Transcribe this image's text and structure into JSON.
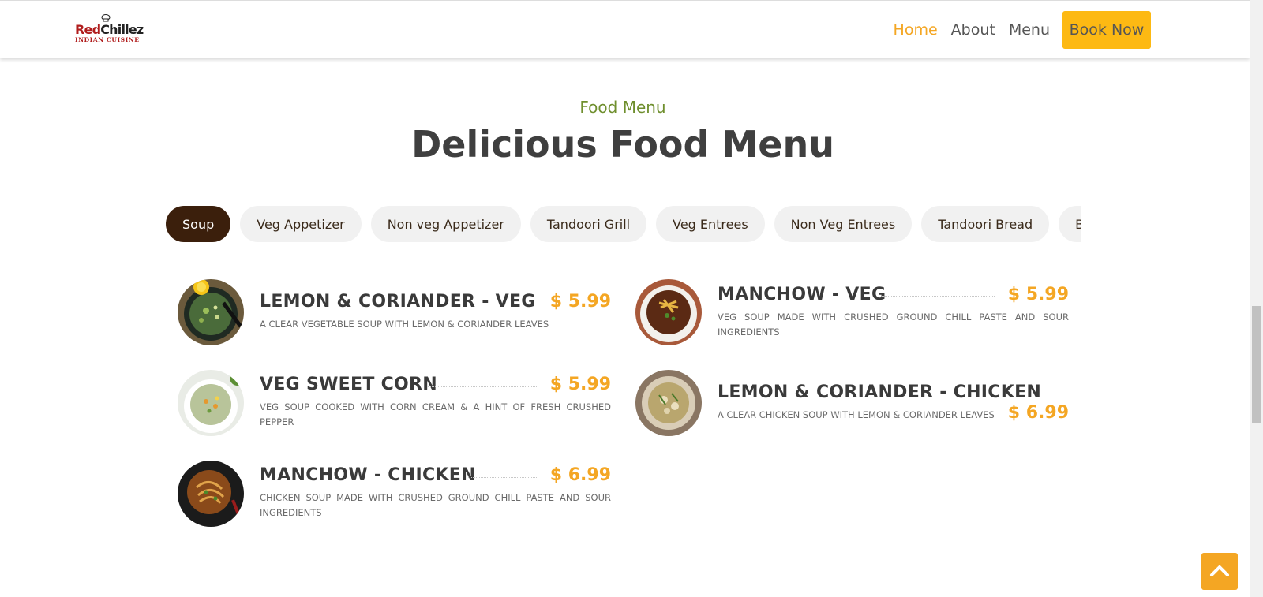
{
  "brand": {
    "name_part1": "Red",
    "name_part2": "Chillez",
    "tagline": "INDIAN CUISINE",
    "brand_color": "#b01d1d"
  },
  "nav": {
    "items": [
      {
        "label": "Home",
        "active": true
      },
      {
        "label": "About",
        "active": false
      },
      {
        "label": "Menu",
        "active": false
      }
    ],
    "book_label": "Book Now",
    "accent_color": "#f4a623",
    "button_color": "#fdb913"
  },
  "section": {
    "subtitle": "Food Menu",
    "title": "Delicious Food Menu"
  },
  "tabs": [
    {
      "label": "Soup",
      "active": true
    },
    {
      "label": "Veg Appetizer",
      "active": false
    },
    {
      "label": "Non veg Appetizer",
      "active": false
    },
    {
      "label": "Tandoori Grill",
      "active": false
    },
    {
      "label": "Veg Entrees",
      "active": false
    },
    {
      "label": "Non Veg Entrees",
      "active": false
    },
    {
      "label": "Tandoori Bread",
      "active": false
    },
    {
      "label": "Bi",
      "active": false
    }
  ],
  "menu_items": [
    {
      "name": "LEMON & CORIANDER - VEG",
      "price": "$ 5.99",
      "description": "A CLEAR VEGETABLE SOUP WITH LEMON & CORIANDER LEAVES",
      "icon": "lemon-coriander-soup-image"
    },
    {
      "name": "MANCHOW - VEG",
      "price": "$ 5.99",
      "description": "VEG SOUP MADE WITH CRUSHED GROUND CHILL PASTE AND SOUR INGREDIENTS",
      "icon": "manchow-veg-soup-image"
    },
    {
      "name": "VEG SWEET CORN",
      "price": "$ 5.99",
      "description": "VEG SOUP COOKED WITH CORN CREAM & A HINT OF FRESH CRUSHED PEPPER",
      "icon": "sweet-corn-soup-image"
    },
    {
      "name": "LEMON & CORIANDER - CHICKEN",
      "price": "$ 6.99",
      "description": "A CLEAR CHICKEN SOUP WITH LEMON & CORIANDER LEAVES",
      "icon": "chicken-coriander-soup-image"
    },
    {
      "name": "MANCHOW - CHICKEN",
      "price": "$ 6.99",
      "description": "CHICKEN SOUP MADE WITH CRUSHED GROUND CHILL PASTE AND SOUR INGREDIENTS",
      "icon": "manchow-chicken-soup-image"
    }
  ],
  "back_to_top_icon": "chevron-up-icon"
}
